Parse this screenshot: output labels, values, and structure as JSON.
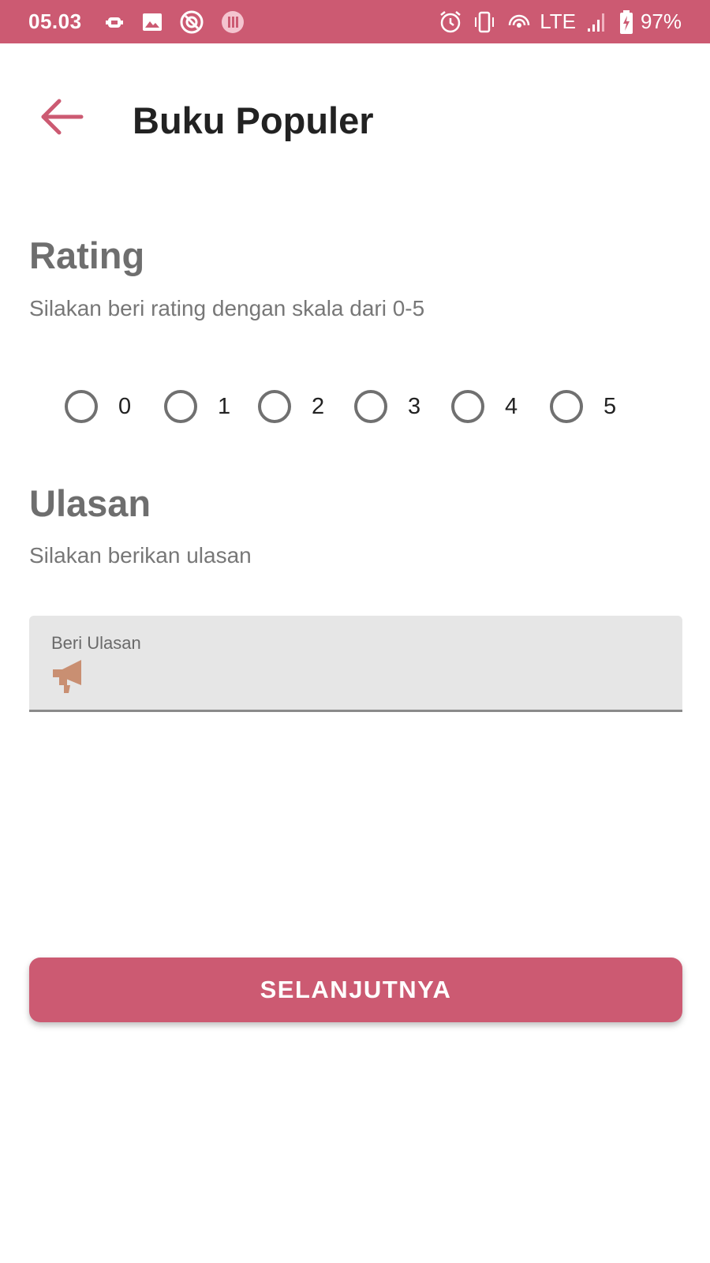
{
  "status_bar": {
    "time": "05.03",
    "network": "LTE",
    "battery": "97%",
    "left_icons": [
      "android-debug-icon",
      "image-icon",
      "blocked-app-icon",
      "media-app-icon"
    ],
    "right_icons": [
      "alarm-icon",
      "vibrate-icon",
      "hotspot-icon",
      "signal-icon",
      "battery-charging-icon"
    ]
  },
  "app_bar": {
    "title": "Buku Populer",
    "back_icon": "arrow-back-icon"
  },
  "rating": {
    "title": "Rating",
    "description": "Silakan beri rating dengan skala dari 0-5",
    "options": [
      "0",
      "1",
      "2",
      "3",
      "4",
      "5"
    ],
    "selected": null
  },
  "review": {
    "title": "Ulasan",
    "description": "Silakan berikan ulasan",
    "field_label": "Beri Ulasan",
    "field_value": "",
    "field_icon": "megaphone-icon"
  },
  "actions": {
    "next_label": "SELANJUTNYA"
  },
  "colors": {
    "accent": "#cc5a72",
    "icon_tint": "#c98f72",
    "field_bg": "#e6e6e6"
  }
}
